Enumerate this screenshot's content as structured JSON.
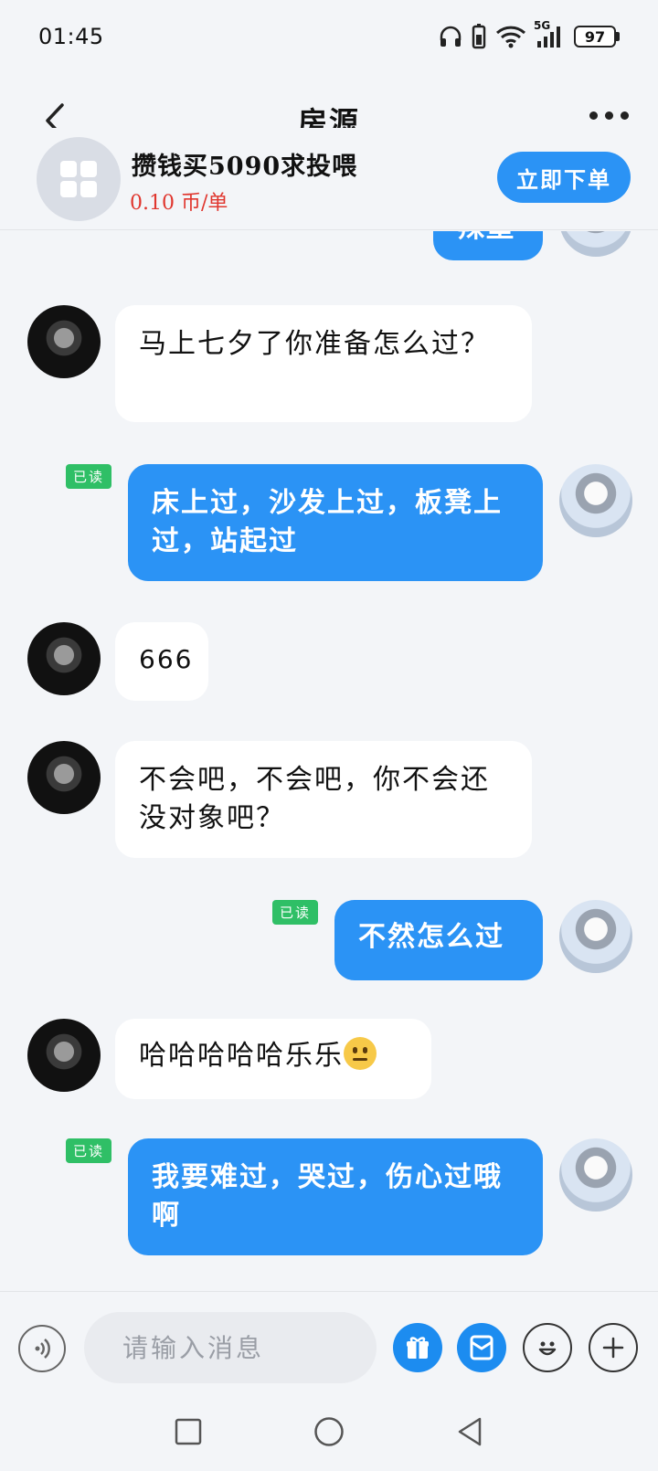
{
  "status_bar": {
    "time": "01:45",
    "network": "5G",
    "battery": "97"
  },
  "header": {
    "title": "房源"
  },
  "order": {
    "product_name": "攒钱买5090求投喂",
    "price": "0.10 币/单",
    "order_button": "立即下单"
  },
  "messages": [
    {
      "side": "out",
      "text": "辣堡",
      "partial": true
    },
    {
      "side": "in",
      "text": "马上七夕了你准备怎么过？"
    },
    {
      "side": "out",
      "text": "床上过，沙发上过，板凳上过，站起过",
      "read": "已读"
    },
    {
      "side": "in",
      "text": "666"
    },
    {
      "side": "in",
      "text": "不会吧，不会吧，你不会还没对象吧？"
    },
    {
      "side": "out",
      "text": "不然怎么过",
      "read": "已读"
    },
    {
      "side": "in",
      "text": "哈哈哈哈哈乐乐",
      "emoji": "neutral-face"
    },
    {
      "side": "out",
      "text": "我要难过，哭过，伤心过哦啊",
      "read": "已读"
    }
  ],
  "input": {
    "placeholder": "请输入消息"
  },
  "colors": {
    "accent": "#2b93f5",
    "price": "#e0362e",
    "read_badge": "#2fbf66",
    "background": "#f3f5f8"
  },
  "icons": {
    "back": "chevron-left-icon",
    "more": "more-dots-icon",
    "voice": "voice-icon",
    "gift": "gift-icon",
    "envelope": "red-envelope-icon",
    "emoji": "emoji-icon",
    "plus": "plus-icon"
  }
}
